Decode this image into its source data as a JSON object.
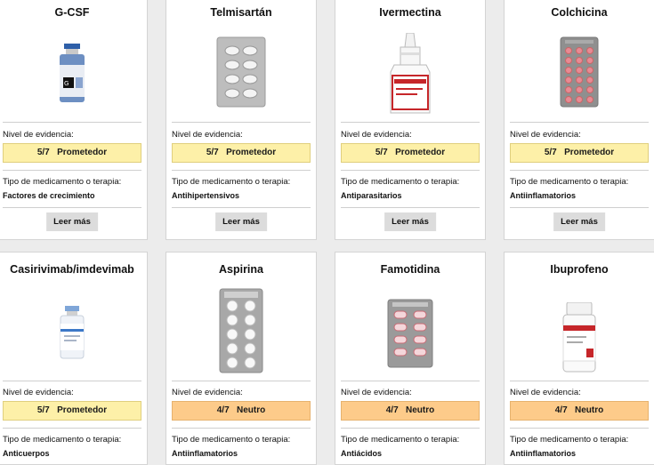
{
  "labels": {
    "evidence": "Nivel de evidencia:",
    "type": "Tipo de medicamento o terapia:",
    "more": "Leer más"
  },
  "cards": [
    {
      "name": "G-CSF",
      "score": "5/7",
      "level": "Prometedor",
      "category": "Factores de crecimiento",
      "icon": "vial-icon"
    },
    {
      "name": "Telmisartán",
      "score": "5/7",
      "level": "Prometedor",
      "category": "Antihipertensivos",
      "icon": "blister-pack-icon"
    },
    {
      "name": "Ivermectina",
      "score": "5/7",
      "level": "Prometedor",
      "category": "Antiparasitarios",
      "icon": "dropper-bottle-icon"
    },
    {
      "name": "Colchicina",
      "score": "5/7",
      "level": "Prometedor",
      "category": "Antiinflamatorios",
      "icon": "blister-pack-icon"
    },
    {
      "name": "Casirivimab/imdevimab",
      "score": "5/7",
      "level": "Prometedor",
      "category": "Anticuerpos",
      "icon": "vial-icon"
    },
    {
      "name": "Aspirina",
      "score": "4/7",
      "level": "Neutro",
      "category": "Antiinflamatorios",
      "icon": "blister-pack-icon"
    },
    {
      "name": "Famotidina",
      "score": "4/7",
      "level": "Neutro",
      "category": "Antiácidos",
      "icon": "blister-pack-icon"
    },
    {
      "name": "Ibuprofeno",
      "score": "4/7",
      "level": "Neutro",
      "category": "Antiinflamatorios",
      "icon": "pill-bottle-icon"
    }
  ],
  "colors": {
    "prometedor": "#fdf0a8",
    "neutro": "#fdcb8a"
  }
}
